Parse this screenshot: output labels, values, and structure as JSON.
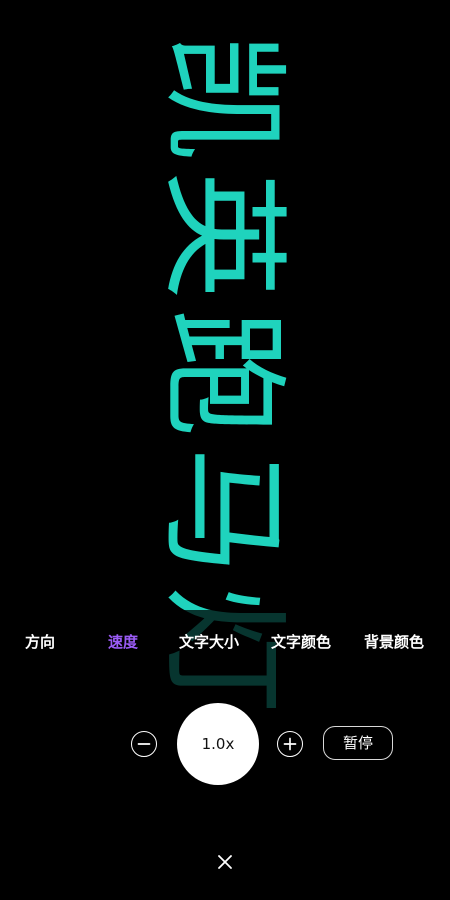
{
  "marquee": {
    "text": [
      "凯",
      "英",
      "跑",
      "马",
      "灯"
    ],
    "color": "#1fd3bd",
    "background": "#000000",
    "direction": "vertical"
  },
  "tabs": [
    {
      "label": "方向",
      "active": false
    },
    {
      "label": "速度",
      "active": true
    },
    {
      "label": "文字大小",
      "active": false
    },
    {
      "label": "文字颜色",
      "active": false
    },
    {
      "label": "背景颜色",
      "active": false
    }
  ],
  "colors": {
    "active_tab": "#9b5cf6",
    "inactive_tab": "#ffffff"
  },
  "controls": {
    "speed_value": "1.0x",
    "pause_label": "暂停",
    "minus_icon": "minus-circle-icon",
    "plus_icon": "plus-circle-icon",
    "close_icon": "close-icon"
  }
}
